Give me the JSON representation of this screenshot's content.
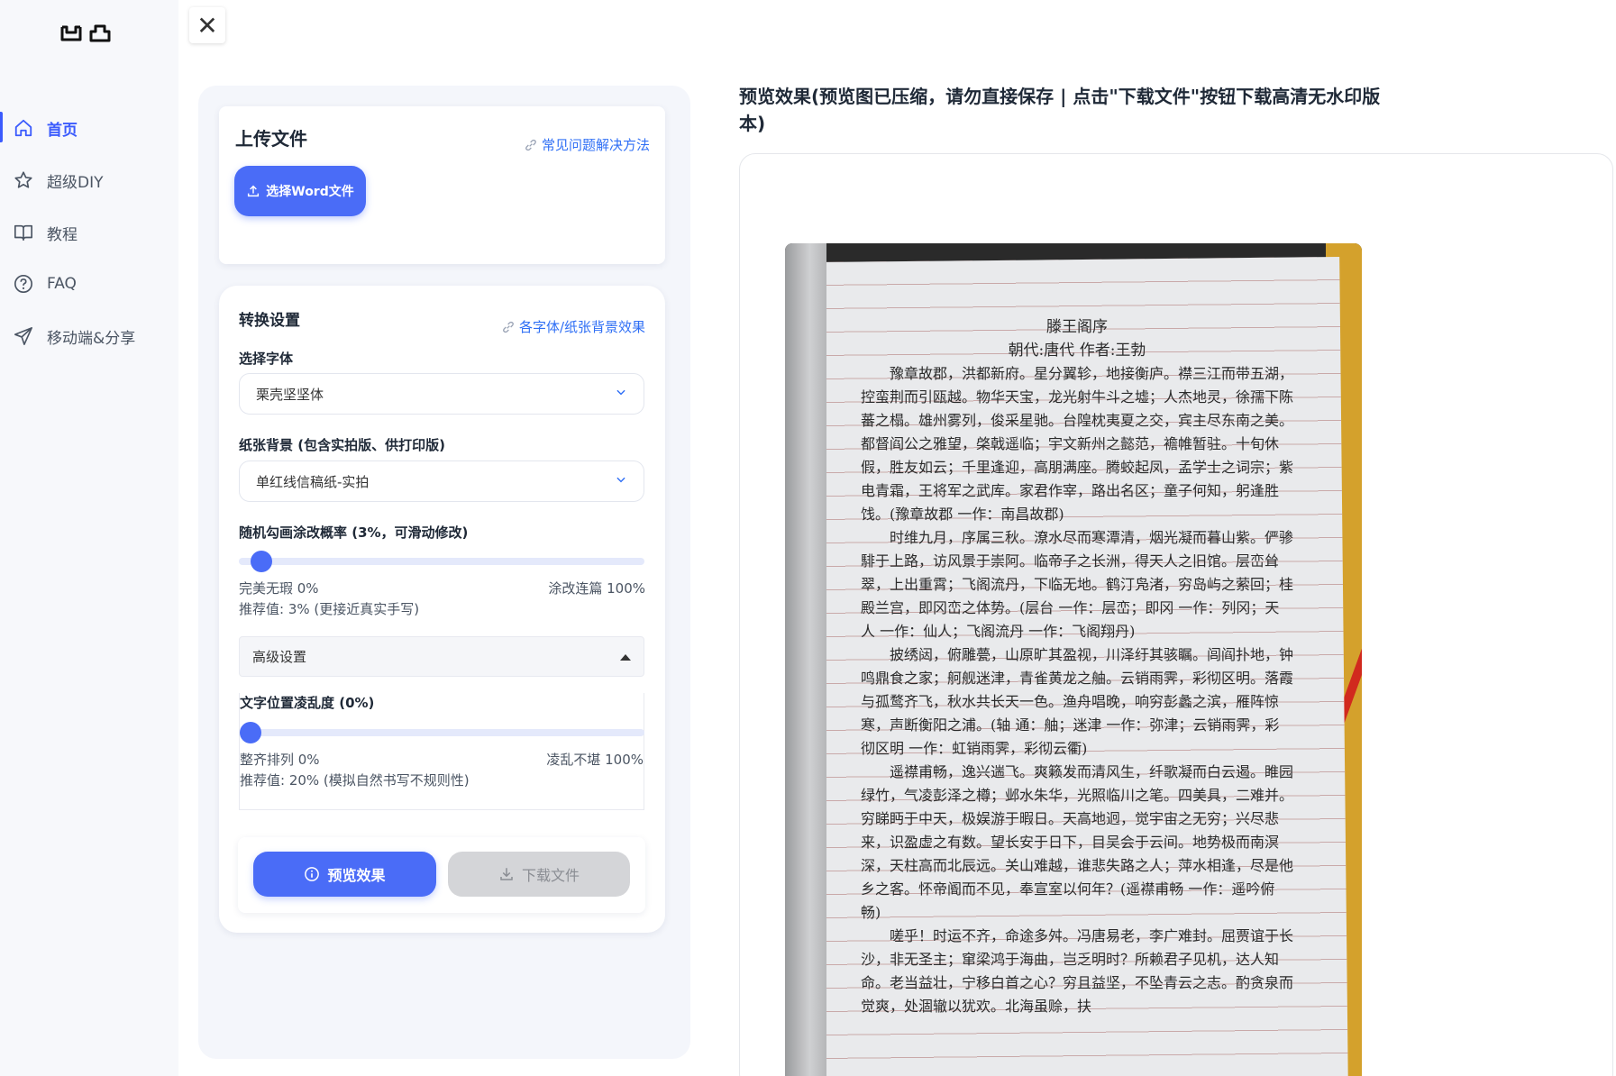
{
  "sidebar": {
    "logo": "ꟽ 凸",
    "items": [
      {
        "label": "首页",
        "icon": "home-icon"
      },
      {
        "label": "超级DIY",
        "icon": "star-icon"
      },
      {
        "label": "教程",
        "icon": "book-icon"
      },
      {
        "label": "FAQ",
        "icon": "question-circle-icon"
      },
      {
        "label": "移动端&分享",
        "icon": "send-icon"
      }
    ]
  },
  "upload": {
    "title": "上传文件",
    "faq_link": "常见问题解决方法",
    "button": "选择Word文件"
  },
  "settings": {
    "title": "转换设置",
    "effects_link": "各字体/纸张背景效果",
    "font_label": "选择字体",
    "font_value": "栗壳坚坚体",
    "paper_label": "纸张背景 (包含实拍版、供打印版)",
    "paper_value": "单红线信稿纸-实拍",
    "scribble_label": "随机勾画涂改概率 (3%，可滑动修改)",
    "scribble_value": 0.03,
    "scribble_min": "完美无瑕 0%",
    "scribble_max": "涂改连篇 100%",
    "scribble_hint": "推荐值: 3% (更接近真实手写)",
    "advanced_label": "高级设置",
    "chaos_label": "文字位置凌乱度 (0%)",
    "chaos_value": 0,
    "chaos_min": "整齐排列 0%",
    "chaos_max": "凌乱不堪 100%",
    "chaos_hint": "推荐值: 20% (模拟自然书写不规则性)"
  },
  "actions": {
    "preview": "预览效果",
    "download": "下载文件"
  },
  "preview": {
    "title": "预览效果(预览图已压缩，请勿直接保存 | 点击\"下载文件\"按钮下载高清无水印版本)",
    "doc_title": "滕王阁序",
    "doc_byline": "朝代:唐代 作者:王勃",
    "doc_paragraphs": [
      "豫章故郡，洪都新府。星分翼轸，地接衡庐。襟三江而带五湖，控蛮荆而引瓯越。物华天宝，龙光射牛斗之墟；人杰地灵，徐孺下陈蕃之榻。雄州雾列，俊采星驰。台隍枕夷夏之交，宾主尽东南之美。都督阎公之雅望，棨戟遥临；宇文新州之懿范，襜帷暂驻。十旬休假，胜友如云；千里逢迎，高朋满座。腾蛟起凤，孟学士之词宗；紫电青霜，王将军之武库。家君作宰，路出名区；童子何知，躬逢胜饯。(豫章故郡 一作：南昌故郡)",
      "时维九月，序属三秋。潦水尽而寒潭清，烟光凝而暮山紫。俨骖騑于上路，访风景于崇阿。临帝子之长洲，得天人之旧馆。层峦耸翠，上出重霄；飞阁流丹，下临无地。鹤汀凫渚，穷岛屿之萦回；桂殿兰宫，即冈峦之体势。(层台 一作：层峦；即冈 一作：列冈；天人 一作：仙人；飞阁流丹 一作：飞阁翔丹)",
      "披绣闼，俯雕甍，山原旷其盈视，川泽纡其骇瞩。闾阎扑地，钟鸣鼎食之家；舸舰迷津，青雀黄龙之舳。云销雨霁，彩彻区明。落霞与孤鹜齐飞，秋水共长天一色。渔舟唱晚，响穷彭蠡之滨，雁阵惊寒，声断衡阳之浦。(轴 通：舳；迷津 一作：弥津；云销雨霁，彩彻区明 一作：虹销雨霁，彩彻云衢)",
      "遥襟甫畅，逸兴遄飞。爽籁发而清风生，纤歌凝而白云遏。睢园绿竹，气凌彭泽之樽；邺水朱华，光照临川之笔。四美具，二难并。穷睇眄于中天，极娱游于暇日。天高地迥，觉宇宙之无穷；兴尽悲来，识盈虚之有数。望长安于日下，目吴会于云间。地势极而南溟深，天柱高而北辰远。关山难越，谁悲失路之人；萍水相逢，尽是他乡之客。怀帝阍而不见，奉宣室以何年？(遥襟甫畅 一作：遥吟俯畅)",
      "嗟乎！时运不齐，命途多舛。冯唐易老，李广难封。屈贾谊于长沙，非无圣主；窜梁鸿于海曲，岂乏明时？所赖君子见机，达人知命。老当益壮，宁移白首之心？穷且益坚，不坠青云之志。酌贪泉而觉爽，处涸辙以犹欢。北海虽赊，扶"
    ]
  }
}
